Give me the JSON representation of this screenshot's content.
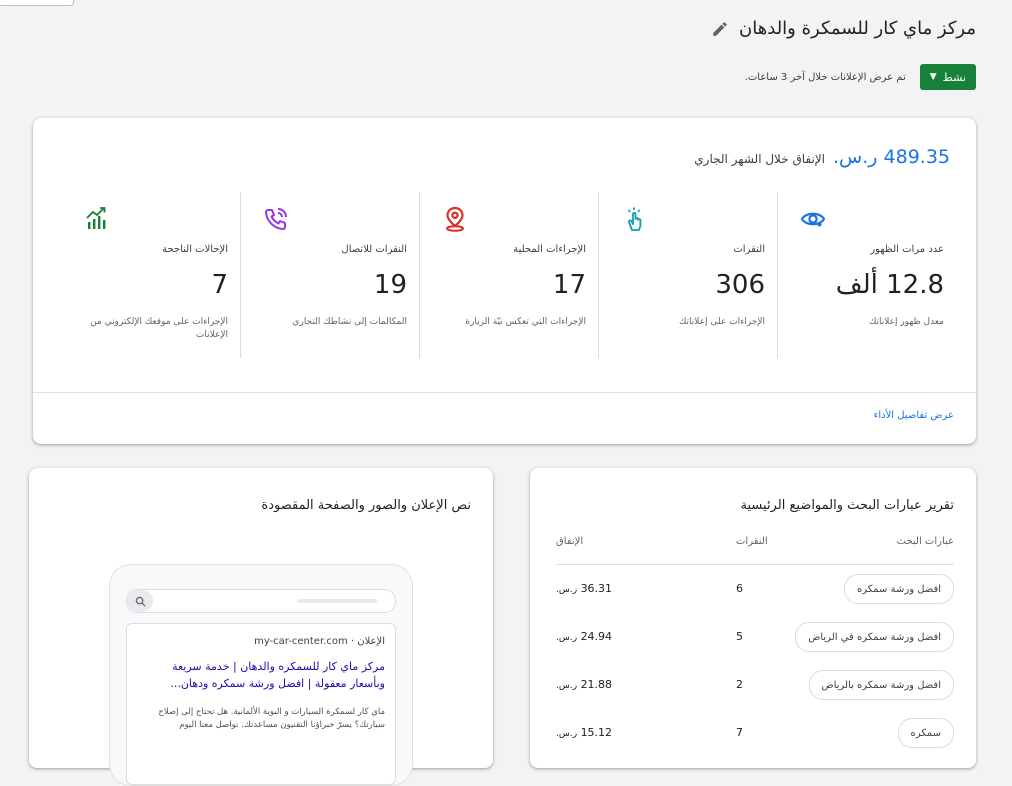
{
  "account": {
    "title": "مركز ماي كار للسمكرة والدهان",
    "status_label": "نشط",
    "status_note": "تم عرض الإعلانات خلال آخر 3 ساعات."
  },
  "performance": {
    "spend_value": "489.35 ر.س.",
    "spend_label": "الإنفاق خلال الشهر الجاري",
    "metrics": [
      {
        "icon": "eye-icon",
        "label": "عدد مرات الظهور",
        "value": "12.8 ألف",
        "desc": "معدل ظهور إعلاناتك"
      },
      {
        "icon": "touch-icon",
        "label": "النقرات",
        "value": "306",
        "desc": "الإجراءات على إعلاناتك"
      },
      {
        "icon": "location-pin-icon",
        "label": "الإجراءات المحلية",
        "value": "17",
        "desc": "الإجراءات التي تعكس نيّة الزيارة"
      },
      {
        "icon": "phone-call-icon",
        "label": "النقرات للاتصال",
        "value": "19",
        "desc": "المكالمات إلى نشاطك التجاري"
      },
      {
        "icon": "trending-bars-icon",
        "label": "الإحالات الناجحة",
        "value": "7",
        "desc": "الإجراءات على موقعك الإلكتروني من الإعلانات"
      }
    ],
    "details_link": "عرض تفاصيل الأداء",
    "colors": {
      "accent": "#1a73e8",
      "green": "#188038",
      "red": "#d93025",
      "purple": "#9334e6",
      "teal": "#129eaf"
    }
  },
  "search_terms": {
    "title": "تقرير عبارات البحث والمواضيع الرئيسية",
    "headers": {
      "term": "عبارات البحث",
      "clicks": "النقرات",
      "spend": "الإنفاق"
    },
    "currency": "ر.س.",
    "rows": [
      {
        "term": "افضل ورشة سمكره",
        "clicks": "6",
        "spend": "36.31"
      },
      {
        "term": "افضل ورشة سمكره في الرياض",
        "clicks": "5",
        "spend": "24.94"
      },
      {
        "term": "افضل ورشة سمكره بالرياض",
        "clicks": "2",
        "spend": "21.88"
      },
      {
        "term": "سمكره",
        "clicks": "7",
        "spend": "15.12"
      }
    ]
  },
  "ad_preview": {
    "title": "نص الإعلان والصور والصفحة المقصودة",
    "ad_label": "الإعلان ·",
    "domain": "my-car-center.com",
    "headline": "مركز ماي كار للسمكره والدهان | خدمة سريعة وبأسعار معقولة | افضل ورشة سمكره ودهان...",
    "body": "ماي كار لسمكرة السيارات و البوية الألمانية. هل تحتاج إلى إصلاح سيارتك؟ يسرّ خبراؤنا التقنيون مساعدتك. تواصل معنا اليوم"
  }
}
